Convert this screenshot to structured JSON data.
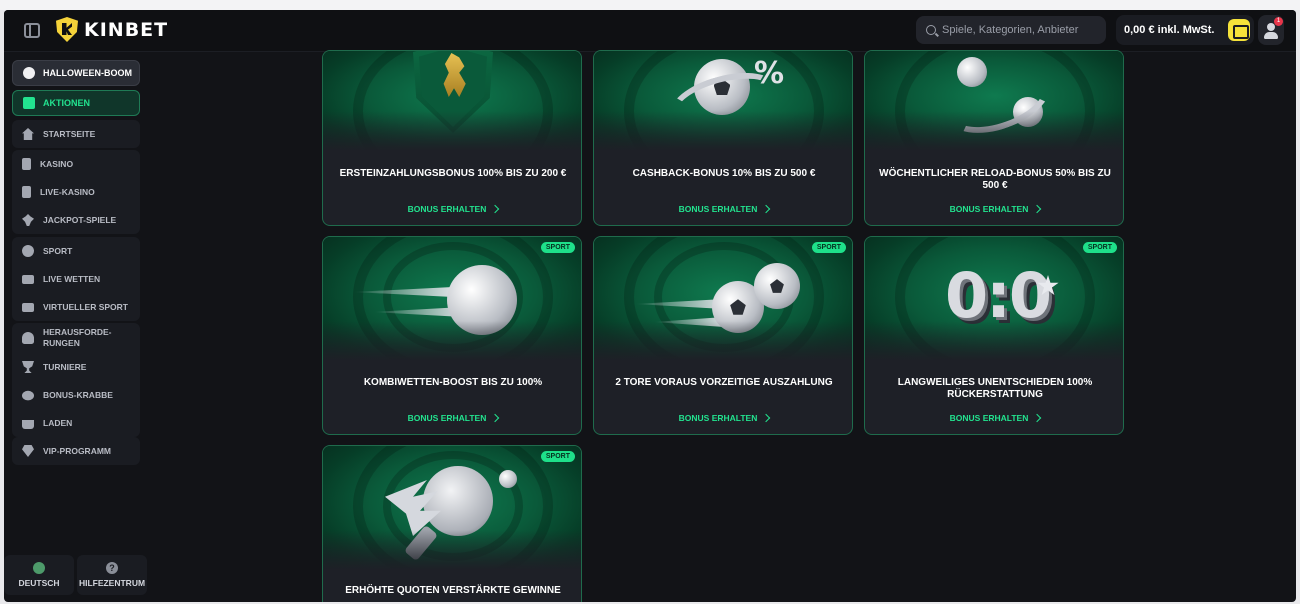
{
  "header": {
    "brand": "KINBET",
    "search_placeholder": "Spiele, Kategorien, Anbieter",
    "balance": "0,00 € inkl. MwSt.",
    "notification_count": "1"
  },
  "sidebar": {
    "halloween": "HALLOWEEN-BOOM",
    "aktionen": "AKTIONEN",
    "start": "STARTSEITE",
    "casino_group": [
      "KASINO",
      "LIVE-KASINO",
      "JACKPOT-SPIELE"
    ],
    "sport_group": [
      "SPORT",
      "LIVE WETTEN",
      "VIRTUELLER SPORT"
    ],
    "extras_group": [
      "HERAUSFORDE-RUNGEN",
      "TURNIERE",
      "BONUS-KRABBE",
      "LADEN"
    ],
    "vip": "VIP-PROGRAMM",
    "language": "DEUTSCH",
    "help": "HILFEZENTRUM"
  },
  "cards": [
    {
      "title": "ERSTEINZAHLUNGSBONUS 100% BIS ZU 200 €",
      "cta": "BONUS ERHALTEN",
      "badge": ""
    },
    {
      "title": "CASHBACK-BONUS 10% BIS ZU 500 €",
      "cta": "BONUS ERHALTEN",
      "badge": ""
    },
    {
      "title": "WÖCHENTLICHER RELOAD-BONUS 50% BIS ZU 500 €",
      "cta": "BONUS ERHALTEN",
      "badge": ""
    },
    {
      "title": "KOMBIWETTEN-BOOST BIS ZU 100%",
      "cta": "BONUS ERHALTEN",
      "badge": "SPORT"
    },
    {
      "title": "2 TORE VORAUS VORZEITIGE AUSZAHLUNG",
      "cta": "BONUS ERHALTEN",
      "badge": "SPORT"
    },
    {
      "title": "LANGWEILIGES UNENTSCHIEDEN 100% RÜCKERSTATTUNG",
      "cta": "BONUS ERHALTEN",
      "badge": "SPORT"
    },
    {
      "title": "ERHÖHTE QUOTEN VERSTÄRKTE GEWINNE",
      "cta": "",
      "badge": "SPORT"
    }
  ],
  "art": {
    "percent_sign": "%",
    "score": "0:0"
  },
  "colors": {
    "accent": "#22e38f",
    "card_border": "#1f6b4c",
    "background": "#121317",
    "brand_yellow": "#f5d33a"
  }
}
